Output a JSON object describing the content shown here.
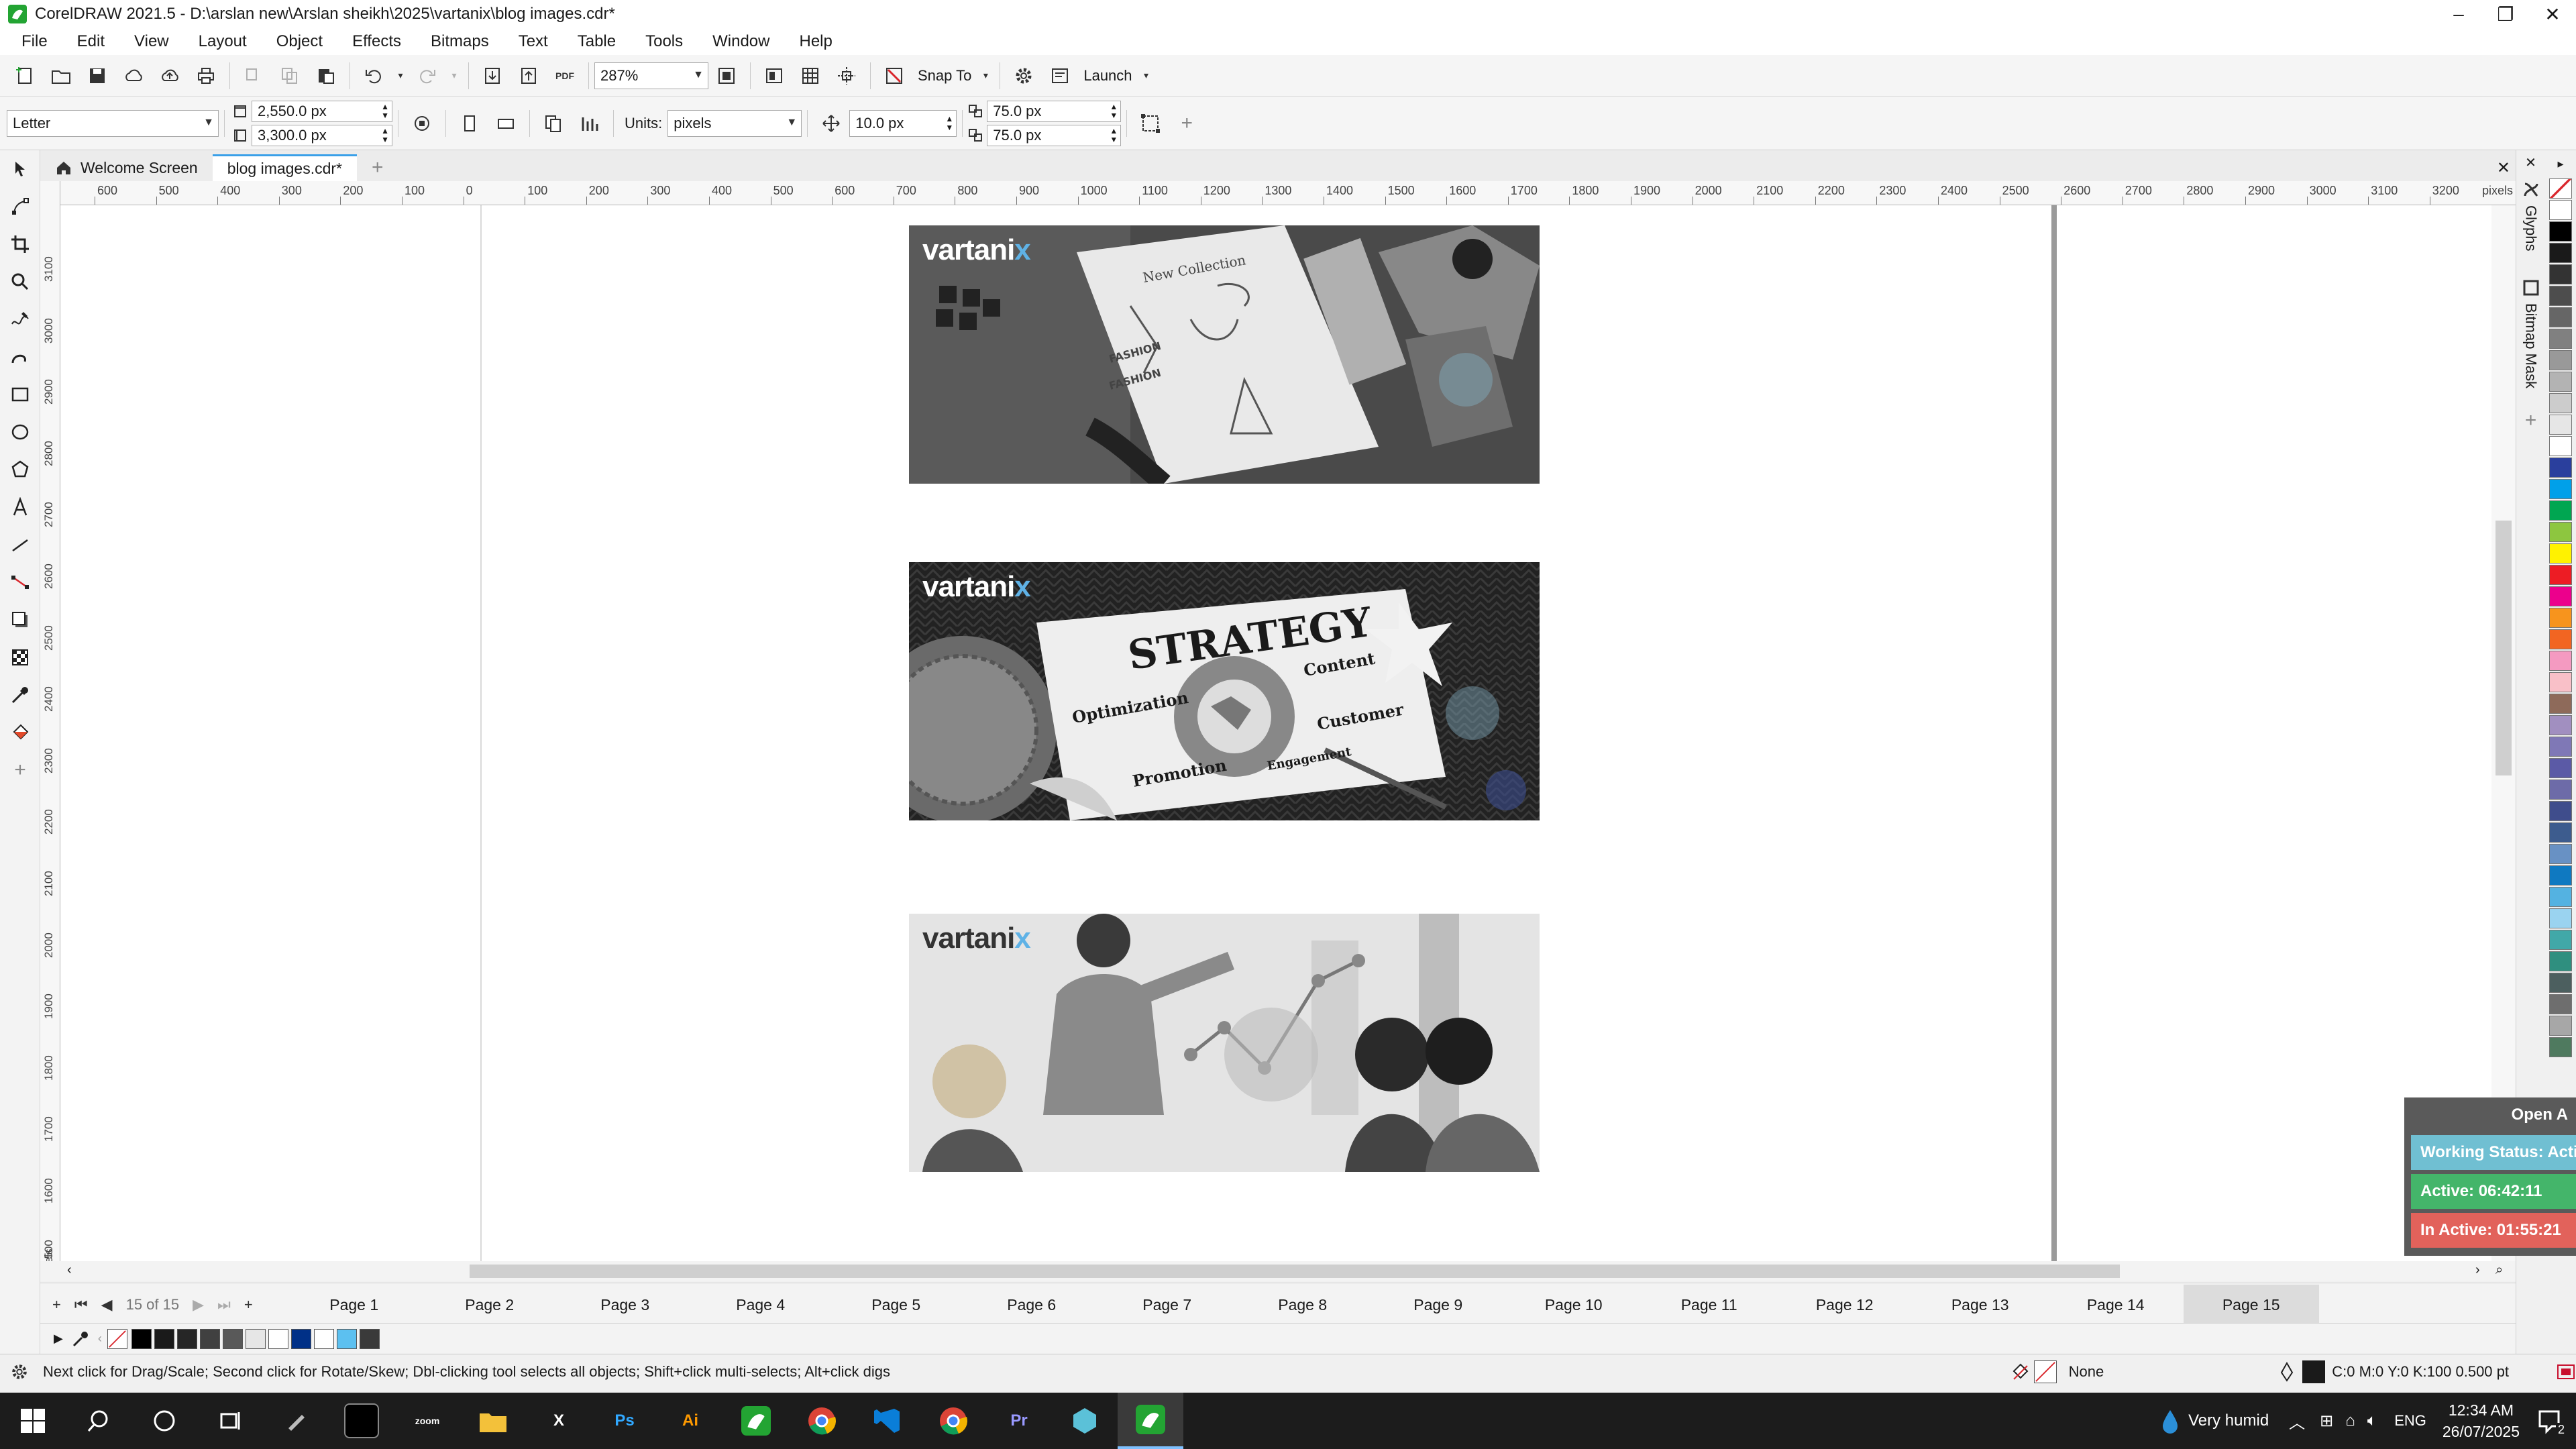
{
  "window": {
    "title": "CorelDRAW 2021.5 - D:\\arslan new\\Arslan sheikh\\2025\\vartanix\\blog images.cdr*"
  },
  "menu": [
    "File",
    "Edit",
    "View",
    "Layout",
    "Object",
    "Effects",
    "Bitmaps",
    "Text",
    "Table",
    "Tools",
    "Window",
    "Help"
  ],
  "standard_toolbar": {
    "zoom": "287%",
    "snap_to": "Snap To",
    "launch": "Launch",
    "pdf_label": "PDF"
  },
  "property_bar": {
    "page_size": "Letter",
    "width": "2,550.0 px",
    "height": "3,300.0 px",
    "units_label": "Units:",
    "units": "pixels",
    "nudge": "10.0 px",
    "dup_x": "75.0 px",
    "dup_y": "75.0 px"
  },
  "doc_tabs": {
    "welcome": "Welcome Screen",
    "document": "blog images.cdr*"
  },
  "ruler": {
    "h_labels": [
      "600",
      "500",
      "400",
      "300",
      "200",
      "100",
      "0",
      "100",
      "200",
      "300",
      "400",
      "500",
      "600",
      "700",
      "800",
      "900",
      "1000",
      "1100",
      "1200",
      "1300",
      "1400",
      "1500",
      "1600",
      "1700",
      "1800",
      "1900",
      "2000",
      "2100",
      "2200",
      "2300",
      "2400",
      "2500",
      "2600",
      "2700",
      "2800",
      "2900",
      "3000",
      "3100",
      "3200"
    ],
    "unit": "pixels",
    "v_labels": [
      "3100",
      "3000",
      "2900",
      "2800",
      "2700",
      "2600",
      "2500",
      "2400",
      "2300",
      "2200",
      "2100",
      "2000",
      "1900",
      "1800",
      "1700",
      "1600",
      "1500"
    ],
    "v_unit": "pixels"
  },
  "canvas": {
    "brand_prefix": "vartani",
    "brand_suffix": "x",
    "strategy_words": {
      "title": "STRATEGY",
      "w1": "Optimization",
      "w2": "Content",
      "w3": "Customer",
      "w4": "Promotion",
      "w5": "Engagement"
    },
    "sketch_words": {
      "w1": "New Collection",
      "w2": "FASHION",
      "w3": "FASHION"
    }
  },
  "dockers": {
    "glyphs": "Glyphs",
    "bitmap_mask": "Bitmap Mask"
  },
  "page_nav": {
    "counter": "15 of 15",
    "pages": [
      "Page 1",
      "Page 2",
      "Page 3",
      "Page 4",
      "Page 5",
      "Page 6",
      "Page 7",
      "Page 8",
      "Page 9",
      "Page 10",
      "Page 11",
      "Page 12",
      "Page 13",
      "Page 14",
      "Page 15"
    ],
    "active": 14
  },
  "status": {
    "hint": "Next click for Drag/Scale; Second click for Rotate/Skew; Dbl-clicking tool selects all objects; Shift+click multi-selects; Alt+click digs",
    "fill": "None",
    "outline": "C:0 M:0 Y:0 K:100  0.500 pt"
  },
  "time_widget": {
    "header": "Open A",
    "working": "Working Status: Acti",
    "active": "Active: 06:42:11",
    "inactive": "In Active: 01:55:21"
  },
  "taskbar": {
    "weather": "Very humid",
    "lang": "ENG",
    "time": "12:34 AM",
    "date": "26/07/2025",
    "notif": "2",
    "apps": [
      {
        "label": "zoom",
        "color": "#2d8cff"
      },
      {
        "label": "X",
        "color": "#1d7044"
      },
      {
        "label": "Ps",
        "color": "#0b1e37"
      },
      {
        "label": "Ai",
        "color": "#330000"
      },
      {
        "label": "Pr",
        "color": "#1a0633"
      }
    ]
  },
  "colors": {
    "accent": "#3aa0e8",
    "palette": [
      "#ffffff",
      "#000000",
      "#1a1a1a",
      "#333333",
      "#4d4d4d",
      "#666666",
      "#808080",
      "#999999",
      "#b3b3b3",
      "#cccccc",
      "#e6e6e6",
      "#ffffff",
      "#2a3f9d",
      "#00a0e9",
      "#00a651",
      "#8dc63f",
      "#fff200",
      "#ed1c24",
      "#ec008c",
      "#f7941d",
      "#f26522",
      "#f49ac1",
      "#f9c0c8",
      "#8e6a5a",
      "#a18fc0",
      "#7f78b6",
      "#5b5aa6",
      "#6d6ba8",
      "#3f4d8c",
      "#3d5c8e",
      "#6891c4",
      "#0f79c1",
      "#54b2e1",
      "#9ad3f0",
      "#41a8a8",
      "#2f8f7f",
      "#4c5f5f",
      "#6e6e6e",
      "#a7a7a7",
      "#4f7a5f"
    ],
    "doc_palette": [
      "#000000",
      "#1a1a1a",
      "#262626",
      "#404040",
      "#595959",
      "#e6e6e6",
      "#ffffff",
      "#003087",
      "#ffffff",
      "#5cc0f0",
      "#3a3a3a"
    ]
  }
}
